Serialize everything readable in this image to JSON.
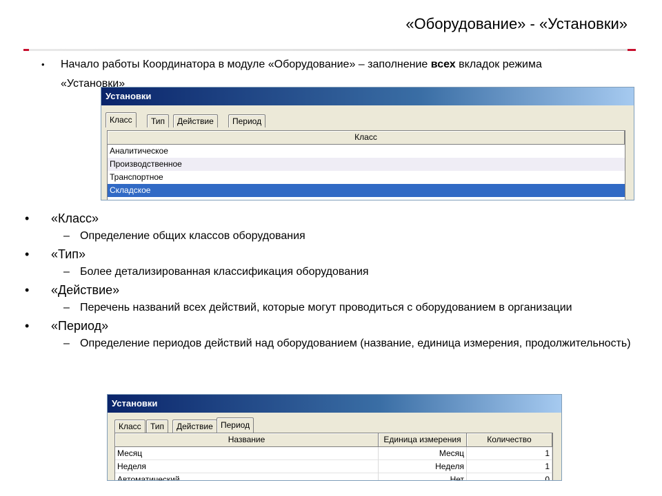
{
  "slide": {
    "title": "«Оборудование» - «Установки»",
    "intro_before": "Начало работы Координатора в модуле «Оборудование» – заполнение ",
    "intro_bold": "всех",
    "intro_after": " вкладок режима «Установки»"
  },
  "window1": {
    "title": "Установки",
    "tabs": [
      "Класс",
      "Тип",
      "Действие",
      "Период"
    ],
    "active_tab": "Класс",
    "column": "Класс",
    "rows": [
      "Аналитическое",
      "Производственное",
      "Транспортное",
      "Складское"
    ],
    "selected_row": "Складское"
  },
  "bullets": [
    {
      "label": "«Класс»",
      "desc": "Определение общих классов оборудования"
    },
    {
      "label": "«Тип»",
      "desc": "Более детализированная классификация оборудования"
    },
    {
      "label": "«Действие»",
      "desc": "Перечень названий всех действий, которые могут проводиться с оборудованием в организации"
    },
    {
      "label": "«Период»",
      "desc": "Определение периодов действий над оборудованием (название, единица измерения, продолжительность)"
    }
  ],
  "window2": {
    "title": "Установки",
    "tabs": [
      "Класс",
      "Тип",
      "Действие",
      "Период"
    ],
    "active_tab": "Период",
    "columns": [
      "Название",
      "Единица измерения",
      "Количество"
    ],
    "rows": [
      {
        "name": "Месяц",
        "unit": "Месяц",
        "count": "1"
      },
      {
        "name": "Неделя",
        "unit": "Неделя",
        "count": "1"
      },
      {
        "name": "Автоматический",
        "unit": "Нет",
        "count": "0"
      }
    ]
  }
}
